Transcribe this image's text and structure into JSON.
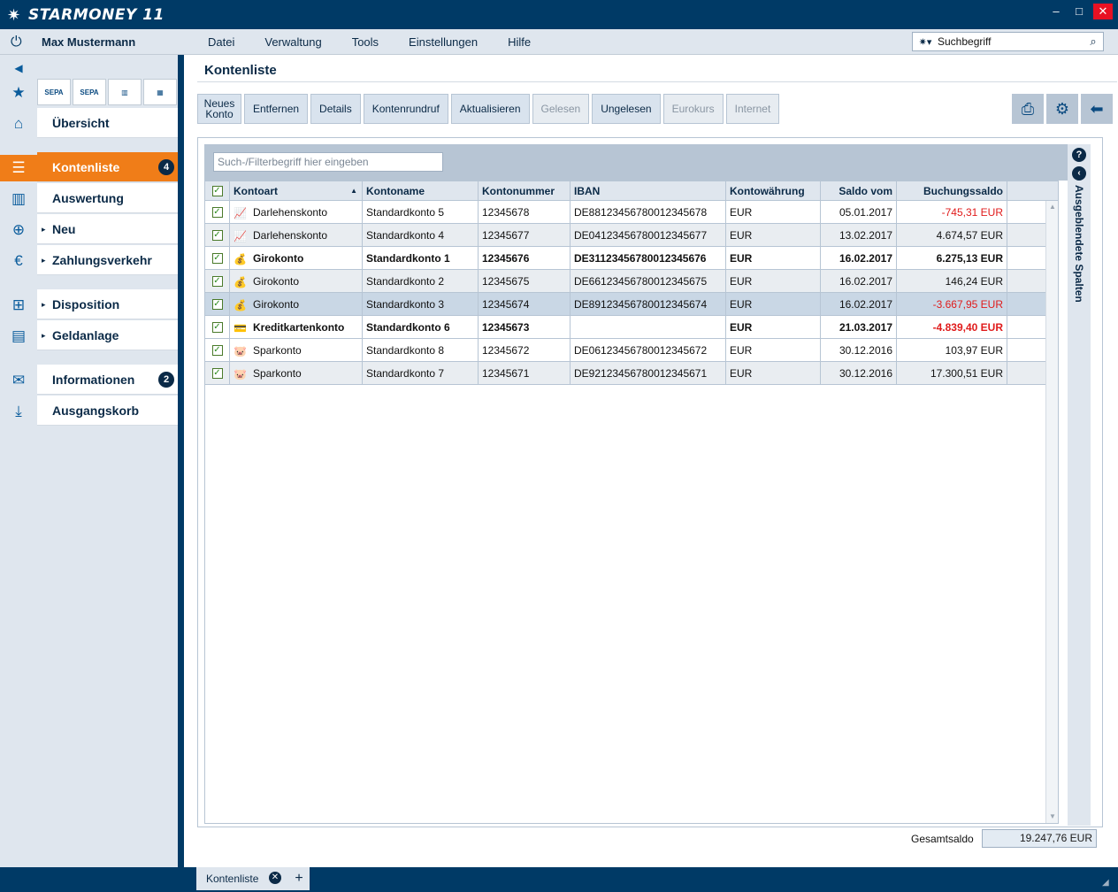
{
  "app": {
    "logo_text": "STARMONEY 11",
    "minimize": "–",
    "maximize": "□",
    "close": "✕"
  },
  "menubar": {
    "user": "Max Mustermann",
    "items": [
      "Datei",
      "Verwaltung",
      "Tools",
      "Einstellungen",
      "Hilfe"
    ],
    "search_value": "Suchbegriff"
  },
  "nav": {
    "tools": [
      "SEPA",
      "SEPA",
      "",
      ""
    ],
    "items": [
      {
        "label": "Übersicht",
        "arrow": "",
        "badge": ""
      },
      {
        "label": "Kontenliste",
        "arrow": "",
        "badge": "4"
      },
      {
        "label": "Auswertung",
        "arrow": "",
        "badge": ""
      },
      {
        "label": "Neu",
        "arrow": "▸",
        "badge": ""
      },
      {
        "label": "Zahlungsverkehr",
        "arrow": "▸",
        "badge": ""
      },
      {
        "label": "Disposition",
        "arrow": "▸",
        "badge": ""
      },
      {
        "label": "Geldanlage",
        "arrow": "▸",
        "badge": ""
      },
      {
        "label": "Informationen",
        "arrow": "",
        "badge": "2"
      },
      {
        "label": "Ausgangskorb",
        "arrow": "",
        "badge": ""
      }
    ]
  },
  "main": {
    "title": "Kontenliste",
    "toolbar": {
      "neues_konto": "Neues Konto",
      "entfernen": "Entfernen",
      "details": "Details",
      "kontenrundruf": "Kontenrundruf",
      "aktualisieren": "Aktualisieren",
      "gelesen": "Gelesen",
      "ungelesen": "Ungelesen",
      "eurokurs": "Eurokurs",
      "internet": "Internet"
    },
    "filter_placeholder": "Such-/Filterbegriff hier eingeben",
    "columns": [
      "Kontoart",
      "Kontoname",
      "Kontonummer",
      "IBAN",
      "Kontowährung",
      "Saldo vom",
      "Buchungssaldo"
    ],
    "rows": [
      {
        "kontoart": "Darlehenskonto",
        "kontoname": "Standardkonto 5",
        "nummer": "12345678",
        "iban": "DE88123456780012345678",
        "waehrung": "EUR",
        "saldo_vom": "05.01.2017",
        "saldo": "-745,31 EUR"
      },
      {
        "kontoart": "Darlehenskonto",
        "kontoname": "Standardkonto 4",
        "nummer": "12345677",
        "iban": "DE04123456780012345677",
        "waehrung": "EUR",
        "saldo_vom": "13.02.2017",
        "saldo": "4.674,57 EUR"
      },
      {
        "kontoart": "Girokonto",
        "kontoname": "Standardkonto 1",
        "nummer": "12345676",
        "iban": "DE31123456780012345676",
        "waehrung": "EUR",
        "saldo_vom": "16.02.2017",
        "saldo": "6.275,13 EUR"
      },
      {
        "kontoart": "Girokonto",
        "kontoname": "Standardkonto 2",
        "nummer": "12345675",
        "iban": "DE66123456780012345675",
        "waehrung": "EUR",
        "saldo_vom": "16.02.2017",
        "saldo": "146,24 EUR"
      },
      {
        "kontoart": "Girokonto",
        "kontoname": "Standardkonto 3",
        "nummer": "12345674",
        "iban": "DE89123456780012345674",
        "waehrung": "EUR",
        "saldo_vom": "16.02.2017",
        "saldo": "-3.667,95 EUR"
      },
      {
        "kontoart": "Kreditkartenkonto",
        "kontoname": "Standardkonto 6",
        "nummer": "12345673",
        "iban": "",
        "waehrung": "EUR",
        "saldo_vom": "21.03.2017",
        "saldo": "-4.839,40 EUR"
      },
      {
        "kontoart": "Sparkonto",
        "kontoname": "Standardkonto 8",
        "nummer": "12345672",
        "iban": "DE06123456780012345672",
        "waehrung": "EUR",
        "saldo_vom": "30.12.2016",
        "saldo": "103,97 EUR"
      },
      {
        "kontoart": "Sparkonto",
        "kontoname": "Standardkonto 7",
        "nummer": "12345671",
        "iban": "DE92123456780012345671",
        "waehrung": "EUR",
        "saldo_vom": "30.12.2016",
        "saldo": "17.300,51 EUR"
      }
    ],
    "sidetab_label": "Ausgeblendete Spalten",
    "total_label": "Gesamtsaldo",
    "total_value": "19.247,76 EUR"
  },
  "tabs": {
    "active": "Kontenliste",
    "add": "+"
  },
  "colors": {
    "accent": "#f07d18",
    "navy": "#003a66",
    "negative": "#e01b1b"
  }
}
